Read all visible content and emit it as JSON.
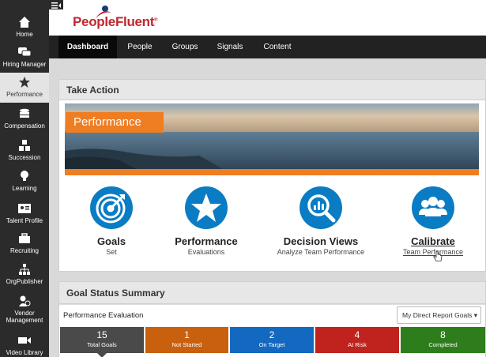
{
  "app": {
    "logo": "PeopleFluent",
    "logo_reg": "®"
  },
  "sidebar": {
    "items": [
      {
        "label": "Home",
        "icon": "home-icon"
      },
      {
        "label": "Hiring Manager",
        "icon": "chat-icon"
      },
      {
        "label": "Performance",
        "icon": "star-icon",
        "active": true
      },
      {
        "label": "Compensation",
        "icon": "coins-icon"
      },
      {
        "label": "Succession",
        "icon": "succession-icon"
      },
      {
        "label": "Learning",
        "icon": "lightbulb-icon"
      },
      {
        "label": "Talent Profile",
        "icon": "id-card-icon"
      },
      {
        "label": "Recruiting",
        "icon": "briefcase-icon"
      },
      {
        "label": "OrgPublisher",
        "icon": "org-chart-icon"
      },
      {
        "label": "Vendor Management",
        "icon": "vendor-icon"
      },
      {
        "label": "Video Library",
        "icon": "video-icon"
      }
    ]
  },
  "nav": {
    "tabs": [
      {
        "label": "Dashboard",
        "active": true
      },
      {
        "label": "People"
      },
      {
        "label": "Groups"
      },
      {
        "label": "Signals"
      },
      {
        "label": "Content"
      }
    ]
  },
  "take_action": {
    "title": "Take Action",
    "banner_label": "Performance",
    "actions": [
      {
        "title": "Goals",
        "sub": "Set",
        "icon": "target-icon"
      },
      {
        "title": "Performance",
        "sub": "Evaluations",
        "icon": "star-icon"
      },
      {
        "title": "Decision Views",
        "sub": "Analyze Team Performance",
        "icon": "magnifier-chart-icon"
      },
      {
        "title": "Calibrate",
        "sub": "Team Performance",
        "icon": "people-icon"
      }
    ]
  },
  "goal_summary": {
    "title": "Goal Status Summary",
    "subtitle": "Performance Evaluation",
    "filter": "My Direct Report Goals ▾",
    "stats": [
      {
        "num": "15",
        "cap": "Total Goals",
        "color": "#4a4a4a"
      },
      {
        "num": "1",
        "cap": "Not Started",
        "color": "#c8600e"
      },
      {
        "num": "2",
        "cap": "On Target",
        "color": "#1368c0"
      },
      {
        "num": "4",
        "cap": "At Risk",
        "color": "#c0221d"
      },
      {
        "num": "8",
        "cap": "Completed",
        "color": "#2e7d1d"
      }
    ]
  },
  "colors": {
    "accent": "#ef7d22",
    "brand": "#c0272d",
    "action_blue": "#0a7cc4"
  }
}
